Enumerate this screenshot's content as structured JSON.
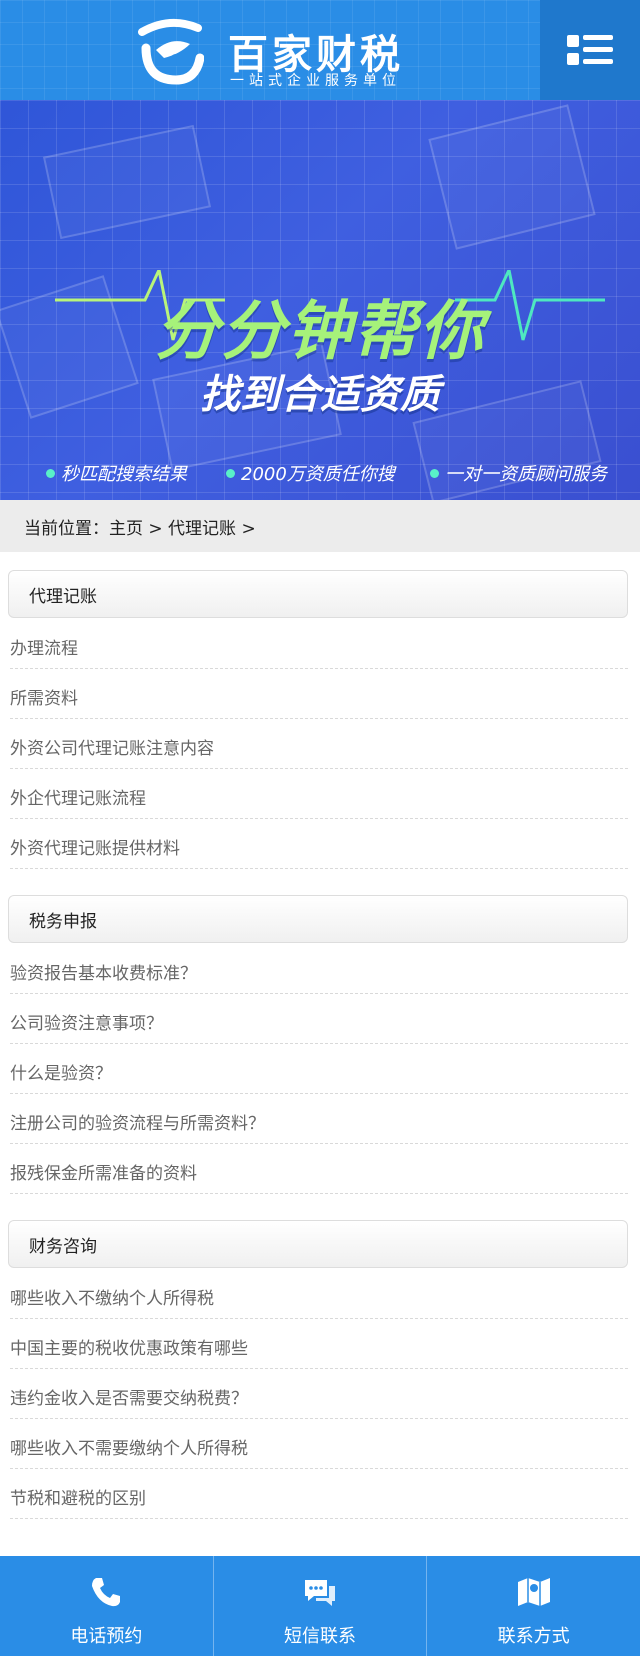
{
  "header": {
    "brand_name": "百家财税",
    "brand_slogan": "一站式企业服务单位"
  },
  "banner": {
    "headline": "分分钟帮你",
    "subhead": "找到合适资质",
    "features": [
      "秒匹配搜索结果",
      "2000万资质任你搜",
      "一对一资质顾问服务"
    ],
    "slides": 2,
    "active_slide": 2,
    "colors": {
      "headline": "#a6f27a",
      "background": "#3f5fe0"
    }
  },
  "breadcrumb": {
    "text": "当前位置：主页 > 代理记账 >"
  },
  "sections": [
    {
      "title": "代理记账",
      "items": [
        "办理流程",
        "所需资料",
        "外资公司代理记账注意内容",
        "外企代理记账流程",
        "外资代理记账提供材料"
      ]
    },
    {
      "title": "税务申报",
      "items": [
        "验资报告基本收费标准？",
        "公司验资注意事项？",
        "什么是验资？",
        "注册公司的验资流程与所需资料？",
        "报残保金所需准备的资料"
      ]
    },
    {
      "title": "财务咨询",
      "items": [
        "哪些收入不缴纳个人所得税",
        "中国主要的税收优惠政策有哪些",
        "违约金收入是否需要交纳税费？",
        "哪些收入不需要缴纳个人所得税",
        "节税和避税的区别"
      ]
    }
  ],
  "footer": {
    "items": [
      {
        "label": "电话预约",
        "icon": "phone-icon"
      },
      {
        "label": "短信联系",
        "icon": "message-icon"
      },
      {
        "label": "联系方式",
        "icon": "map-icon"
      }
    ]
  },
  "colors": {
    "primary": "#2a8de6",
    "menu_bg": "#1f78cc"
  }
}
